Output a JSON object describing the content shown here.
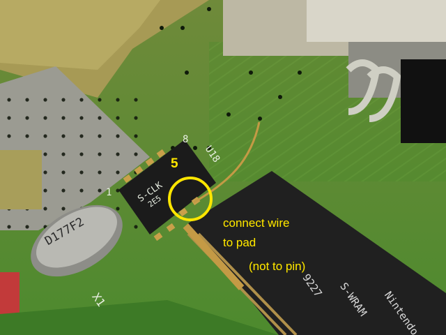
{
  "annotation": {
    "pin_number": "5",
    "caption_line1": "connect wire",
    "caption_line2": "to pad",
    "caption_line3": "(not to pin)",
    "color": "#ffe600"
  },
  "pcb_labels": {
    "chip_marking_1": "S-CLK",
    "chip_marking_2": "2E5",
    "ref_u18": "U18",
    "ref_x1": "X1",
    "ref_8": "8",
    "ref_1": "1",
    "crystal_marking": "D177F2",
    "ram_brand": "Nintendo",
    "ram_part": "S-WRAM",
    "ram_code": "9227"
  },
  "colors": {
    "pcb_green": "#4f8a2c",
    "pcb_dark": "#2f5f1f",
    "solder_gold": "#c79a3a",
    "chip_black": "#1b1b1b",
    "shield_metal": "#9a9a92"
  }
}
